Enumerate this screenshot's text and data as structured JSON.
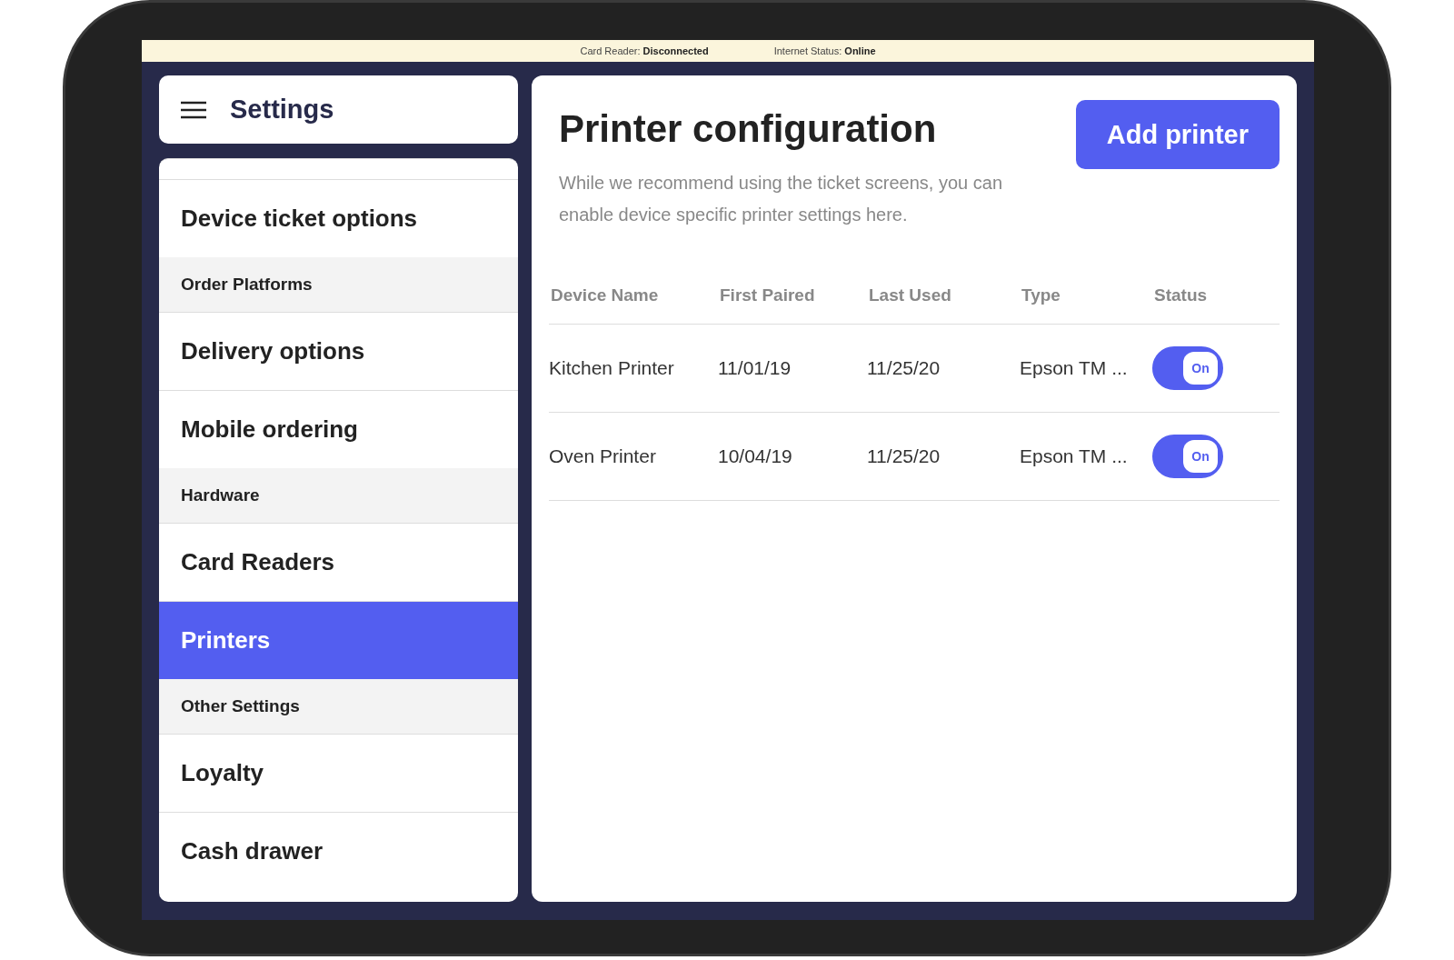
{
  "status_bar": [
    {
      "label": "Card Reader:",
      "value": "Disconnected"
    },
    {
      "label": "Internet Status:",
      "value": "Online"
    }
  ],
  "sidebar": {
    "title": "Settings",
    "items": [
      {
        "kind": "item",
        "label": "Device ticket options",
        "selected": false
      },
      {
        "kind": "section",
        "label": "Order Platforms"
      },
      {
        "kind": "item",
        "label": "Delivery options",
        "selected": false
      },
      {
        "kind": "item",
        "label": "Mobile ordering",
        "selected": false
      },
      {
        "kind": "section",
        "label": "Hardware"
      },
      {
        "kind": "item",
        "label": "Card Readers",
        "selected": false
      },
      {
        "kind": "item",
        "label": "Printers",
        "selected": true
      },
      {
        "kind": "section",
        "label": "Other Settings"
      },
      {
        "kind": "item",
        "label": "Loyalty",
        "selected": false
      },
      {
        "kind": "item",
        "label": "Cash drawer",
        "selected": false
      }
    ]
  },
  "main": {
    "title": "Printer configuration",
    "description": "While we recommend using the ticket screens, you can enable device specific printer settings here.",
    "add_button": "Add printer",
    "table": {
      "columns": [
        "Device Name",
        "First Paired",
        "Last Used",
        "Type",
        "Status"
      ],
      "rows": [
        {
          "name": "Kitchen Printer",
          "first_paired": "11/01/19",
          "last_used": "11/25/20",
          "type": "Epson TM ...",
          "status": {
            "on": true,
            "label": "On"
          }
        },
        {
          "name": "Oven Printer",
          "first_paired": "10/04/19",
          "last_used": "11/25/20",
          "type": "Epson TM ...",
          "status": {
            "on": true,
            "label": "On"
          }
        }
      ]
    }
  }
}
